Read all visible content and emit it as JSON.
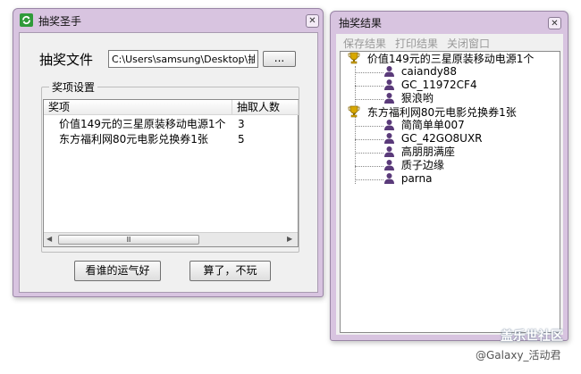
{
  "left_window": {
    "title": "抽奖圣手",
    "app_icon": "green-refresh-icon",
    "close_icon": "close-icon",
    "file_label": "抽奖文件",
    "file_path": "C:\\Users\\samsung\\Desktop\\抽奖名",
    "browse_label": "...",
    "group_title": "奖项设置",
    "columns": [
      "奖项",
      "抽取人数"
    ],
    "prizes": [
      {
        "name": "价值149元的三星原装移动电源1个",
        "count": "3"
      },
      {
        "name": "东方福利网80元电影兑换券1张",
        "count": "5"
      }
    ],
    "scroll_grip": "Ⅲ",
    "draw_button": "看谁的运气好",
    "cancel_button": "算了，不玩"
  },
  "right_window": {
    "title": "抽奖结果",
    "close_icon": "close-icon",
    "menu": [
      "保存结果",
      "打印结果",
      "关闭窗口"
    ],
    "results": [
      {
        "prize": "价值149元的三星原装移动电源1个",
        "icon": "trophy-icon",
        "winners": [
          "caiandy88",
          "GC_11972CF4",
          "狠浪哟"
        ]
      },
      {
        "prize": "东方福利网80元电影兑换券1张",
        "icon": "trophy-icon",
        "winners": [
          "简简单单007",
          "GC_42GO8UXR",
          "高朋朋满座",
          "质子边缘",
          "parna"
        ]
      }
    ]
  },
  "watermark": {
    "logo_text": "盖乐世社区",
    "handle": "@Galaxy_活动君"
  },
  "colors": {
    "frame": "#d8c4e0",
    "client": "#f0f0f0",
    "trophy": "#d8a800",
    "user_icon": "#5a3a7a"
  }
}
